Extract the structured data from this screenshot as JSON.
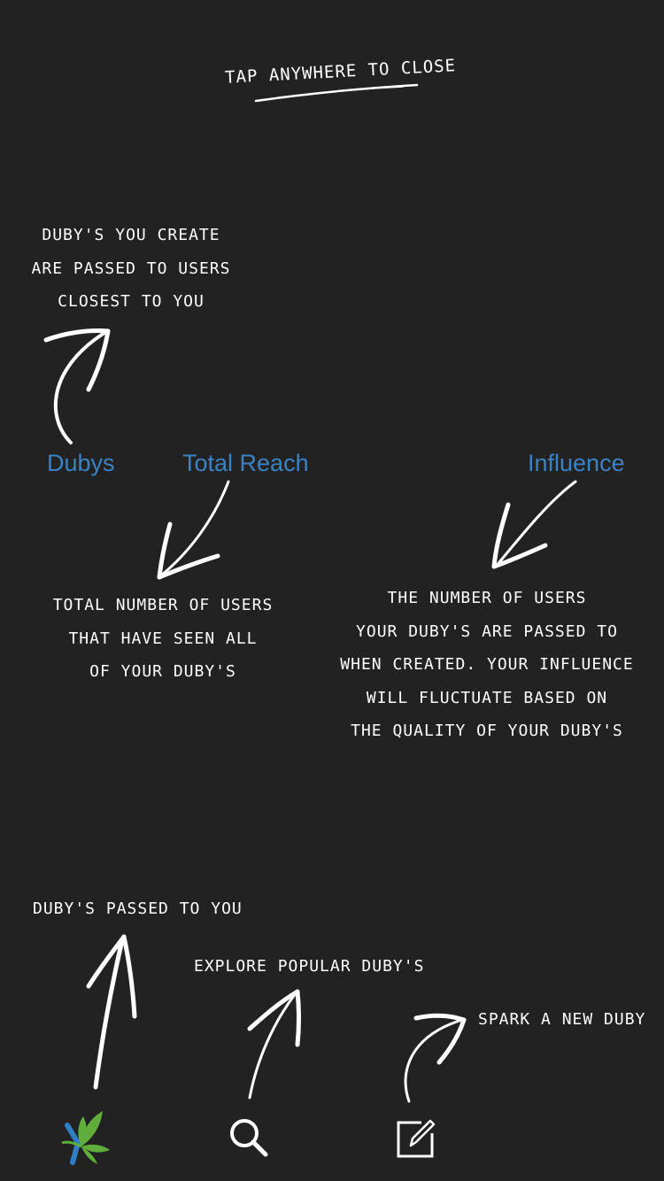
{
  "overlay": {
    "close_hint": "TAP ANYWHERE TO CLOSE"
  },
  "callouts": {
    "dubys_create": [
      "DUBY'S YOU CREATE",
      "ARE PASSED TO USERS",
      "CLOSEST TO YOU"
    ],
    "total_reach": [
      "TOTAL NUMBER OF USERS",
      "THAT HAVE SEEN ALL",
      "OF YOUR DUBY'S"
    ],
    "influence": [
      "THE NUMBER OF USERS",
      "YOUR DUBY'S ARE PASSED TO",
      "WHEN CREATED. YOUR INFLUENCE",
      "WILL FLUCTUATE BASED ON",
      "THE QUALITY OF YOUR DUBY'S"
    ],
    "passed_to_you": "DUBY'S PASSED TO YOU",
    "explore": "EXPLORE POPULAR DUBY'S",
    "spark": "SPARK A NEW DUBY"
  },
  "stats": {
    "dubys": "Dubys",
    "total_reach": "Total Reach",
    "influence": "Influence"
  },
  "tab_bar": {
    "home_icon": "leaf-y-logo-icon",
    "search_icon": "search-icon",
    "compose_icon": "compose-icon"
  },
  "colors": {
    "background": "#222222",
    "text": "#ffffff",
    "accent": "#3b82c4",
    "leaf_green": "#5fae3b",
    "logo_blue": "#2f7fc4"
  }
}
